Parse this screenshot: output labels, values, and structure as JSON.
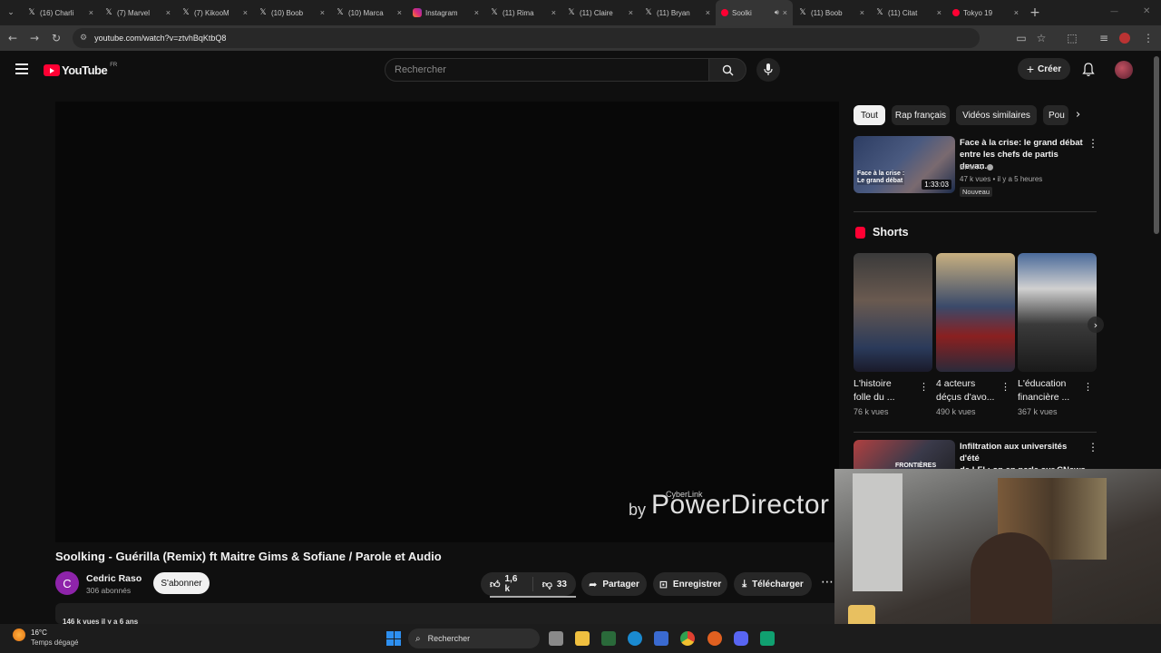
{
  "browser": {
    "tabs": [
      {
        "label": "(16) Charli",
        "icon": "x-icon",
        "active": false
      },
      {
        "label": "(7) Marvel",
        "icon": "x-icon",
        "active": false
      },
      {
        "label": "(7) KikooM",
        "icon": "x-icon",
        "active": false
      },
      {
        "label": "(10) Boob",
        "icon": "x-icon",
        "active": false
      },
      {
        "label": "(10) Marca",
        "icon": "x-icon",
        "active": false
      },
      {
        "label": "Instagram",
        "icon": "instagram-icon",
        "active": false
      },
      {
        "label": "(11) Rima",
        "icon": "x-icon",
        "active": false
      },
      {
        "label": "(11) Claire",
        "icon": "x-icon",
        "active": false
      },
      {
        "label": "(11) Bryan",
        "icon": "x-icon",
        "active": false
      },
      {
        "label": "Soolki",
        "icon": "youtube-icon",
        "active": true
      },
      {
        "label": "(11) Boob",
        "icon": "x-icon",
        "active": false
      },
      {
        "label": "(11) Citat",
        "icon": "x-icon",
        "active": false
      },
      {
        "label": "Tokyo 19",
        "icon": "youtube-icon",
        "active": false
      }
    ],
    "url": "youtube.com/watch?v=ztvhBqKtbQ8"
  },
  "header": {
    "logo_text": "YouTube",
    "country": "FR",
    "search_placeholder": "Rechercher",
    "create_label": "Créer"
  },
  "player": {
    "watermark_by": "by",
    "watermark_brand": "PowerDirector",
    "watermark_top": "CyberLink"
  },
  "video": {
    "title": "Soolking - Guérilla (Remix) ft Maitre Gims & Sofiane / Parole et Audio",
    "channel_initial": "C",
    "channel_name": "Cedric Raso",
    "subscribers": "306 abonnés",
    "subscribe_label": "S'abonner",
    "likes": "1,6 k",
    "dislikes": "33",
    "share_label": "Partager",
    "save_label": "Enregistrer",
    "download_label": "Télécharger",
    "meta": "146 k vues  il y a 6 ans"
  },
  "sidebar": {
    "chips": [
      "Tout",
      "Rap français",
      "Vidéos similaires",
      "Pou"
    ],
    "top_video": {
      "title_line1": "Face à la crise: le grand débat",
      "title_line2": "entre les chefs de partis devan...",
      "channel": "BFMTV",
      "meta": "47 k vues • il y a 5 heures",
      "badge": "Nouveau",
      "duration": "1:33:03",
      "thumb_caption_line1": "Face à la crise :",
      "thumb_caption_line2": "Le grand débat"
    },
    "shorts_heading": "Shorts",
    "shorts": [
      {
        "title_line1": "L'histoire",
        "title_line2": "folle du ...",
        "views": "76 k vues"
      },
      {
        "title_line1": "4 acteurs",
        "title_line2": "déçus d'avo...",
        "views": "490 k vues"
      },
      {
        "title_line1": "L'éducation",
        "title_line2": "financière ...",
        "views": "367 k vues"
      }
    ],
    "next_video": {
      "title_line1": "Infiltration aux universités d'été",
      "title_line2": "de LFI : on en parle sur CNews !",
      "thumb_caption": "FRONTIÈRES"
    }
  },
  "taskbar": {
    "weather_temp": "16°C",
    "weather_text": "Temps dégagé",
    "search_label": "Rechercher"
  }
}
